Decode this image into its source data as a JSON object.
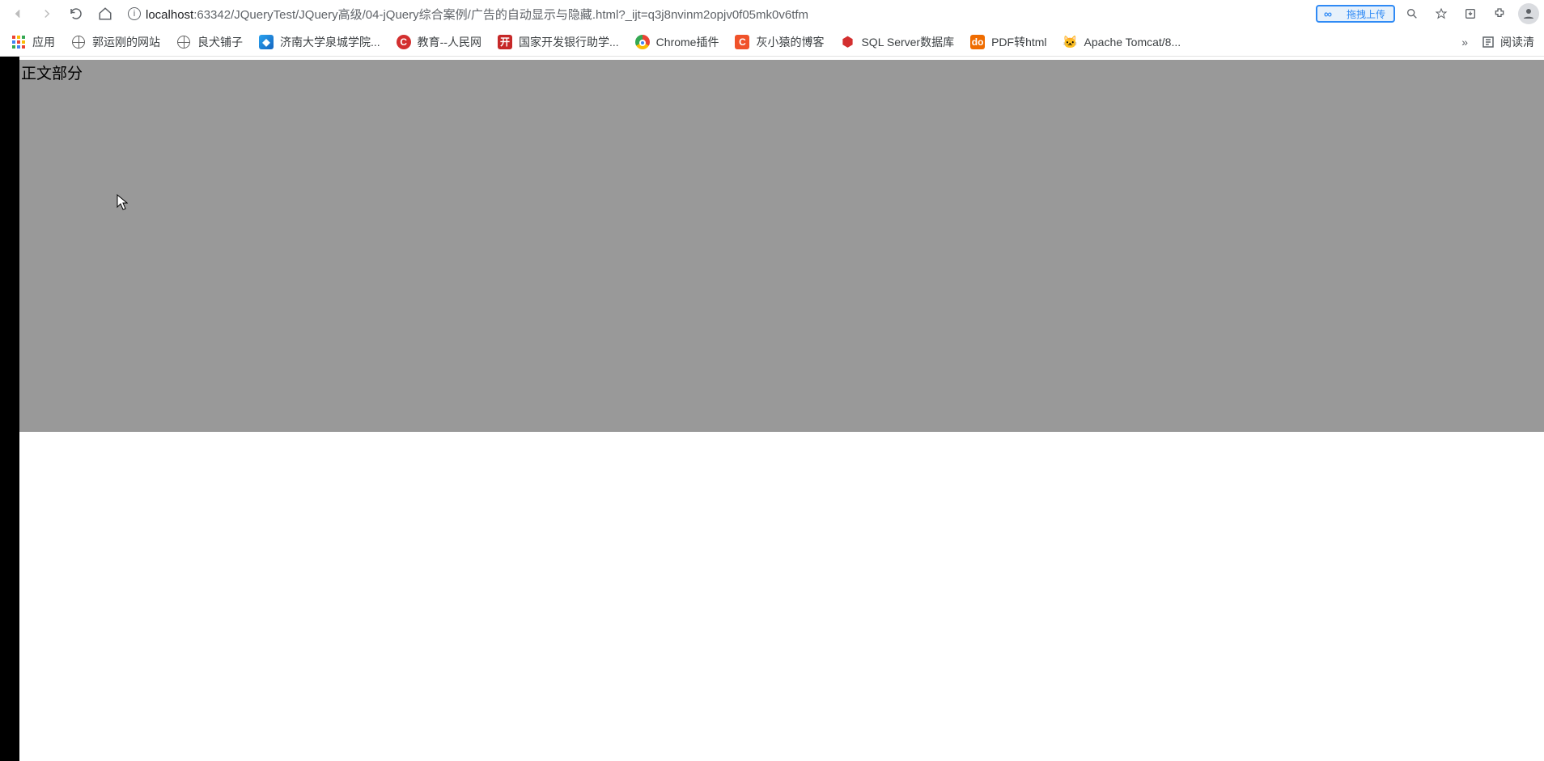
{
  "nav": {
    "url_host": "localhost",
    "url_path": ":63342/JQueryTest/JQuery高级/04-jQuery综合案例/广告的自动显示与隐藏.html?_ijt=q3j8nvinm2opjv0f05mk0v6tfm",
    "upload_label": "拖拽上传"
  },
  "bookmarks": [
    {
      "label": "应用",
      "icon": "apps"
    },
    {
      "label": "郭运刚的网站",
      "icon": "globe"
    },
    {
      "label": "良犬铺子",
      "icon": "globe"
    },
    {
      "label": "济南大学泉城学院...",
      "icon": "cube"
    },
    {
      "label": "教育--人民网",
      "icon": "red-c"
    },
    {
      "label": "国家开发银行助学...",
      "icon": "red-sq"
    },
    {
      "label": "Chrome插件",
      "icon": "chrome"
    },
    {
      "label": "灰小猿的博客",
      "icon": "orange-c"
    },
    {
      "label": "SQL Server数据库",
      "icon": "red-hex"
    },
    {
      "label": "PDF转html",
      "icon": "orange-do"
    },
    {
      "label": "Apache Tomcat/8...",
      "icon": "tomcat"
    }
  ],
  "bookmarks_tail": {
    "overflow": "»",
    "reader": "阅读清"
  },
  "page": {
    "body_text": "正文部分"
  }
}
